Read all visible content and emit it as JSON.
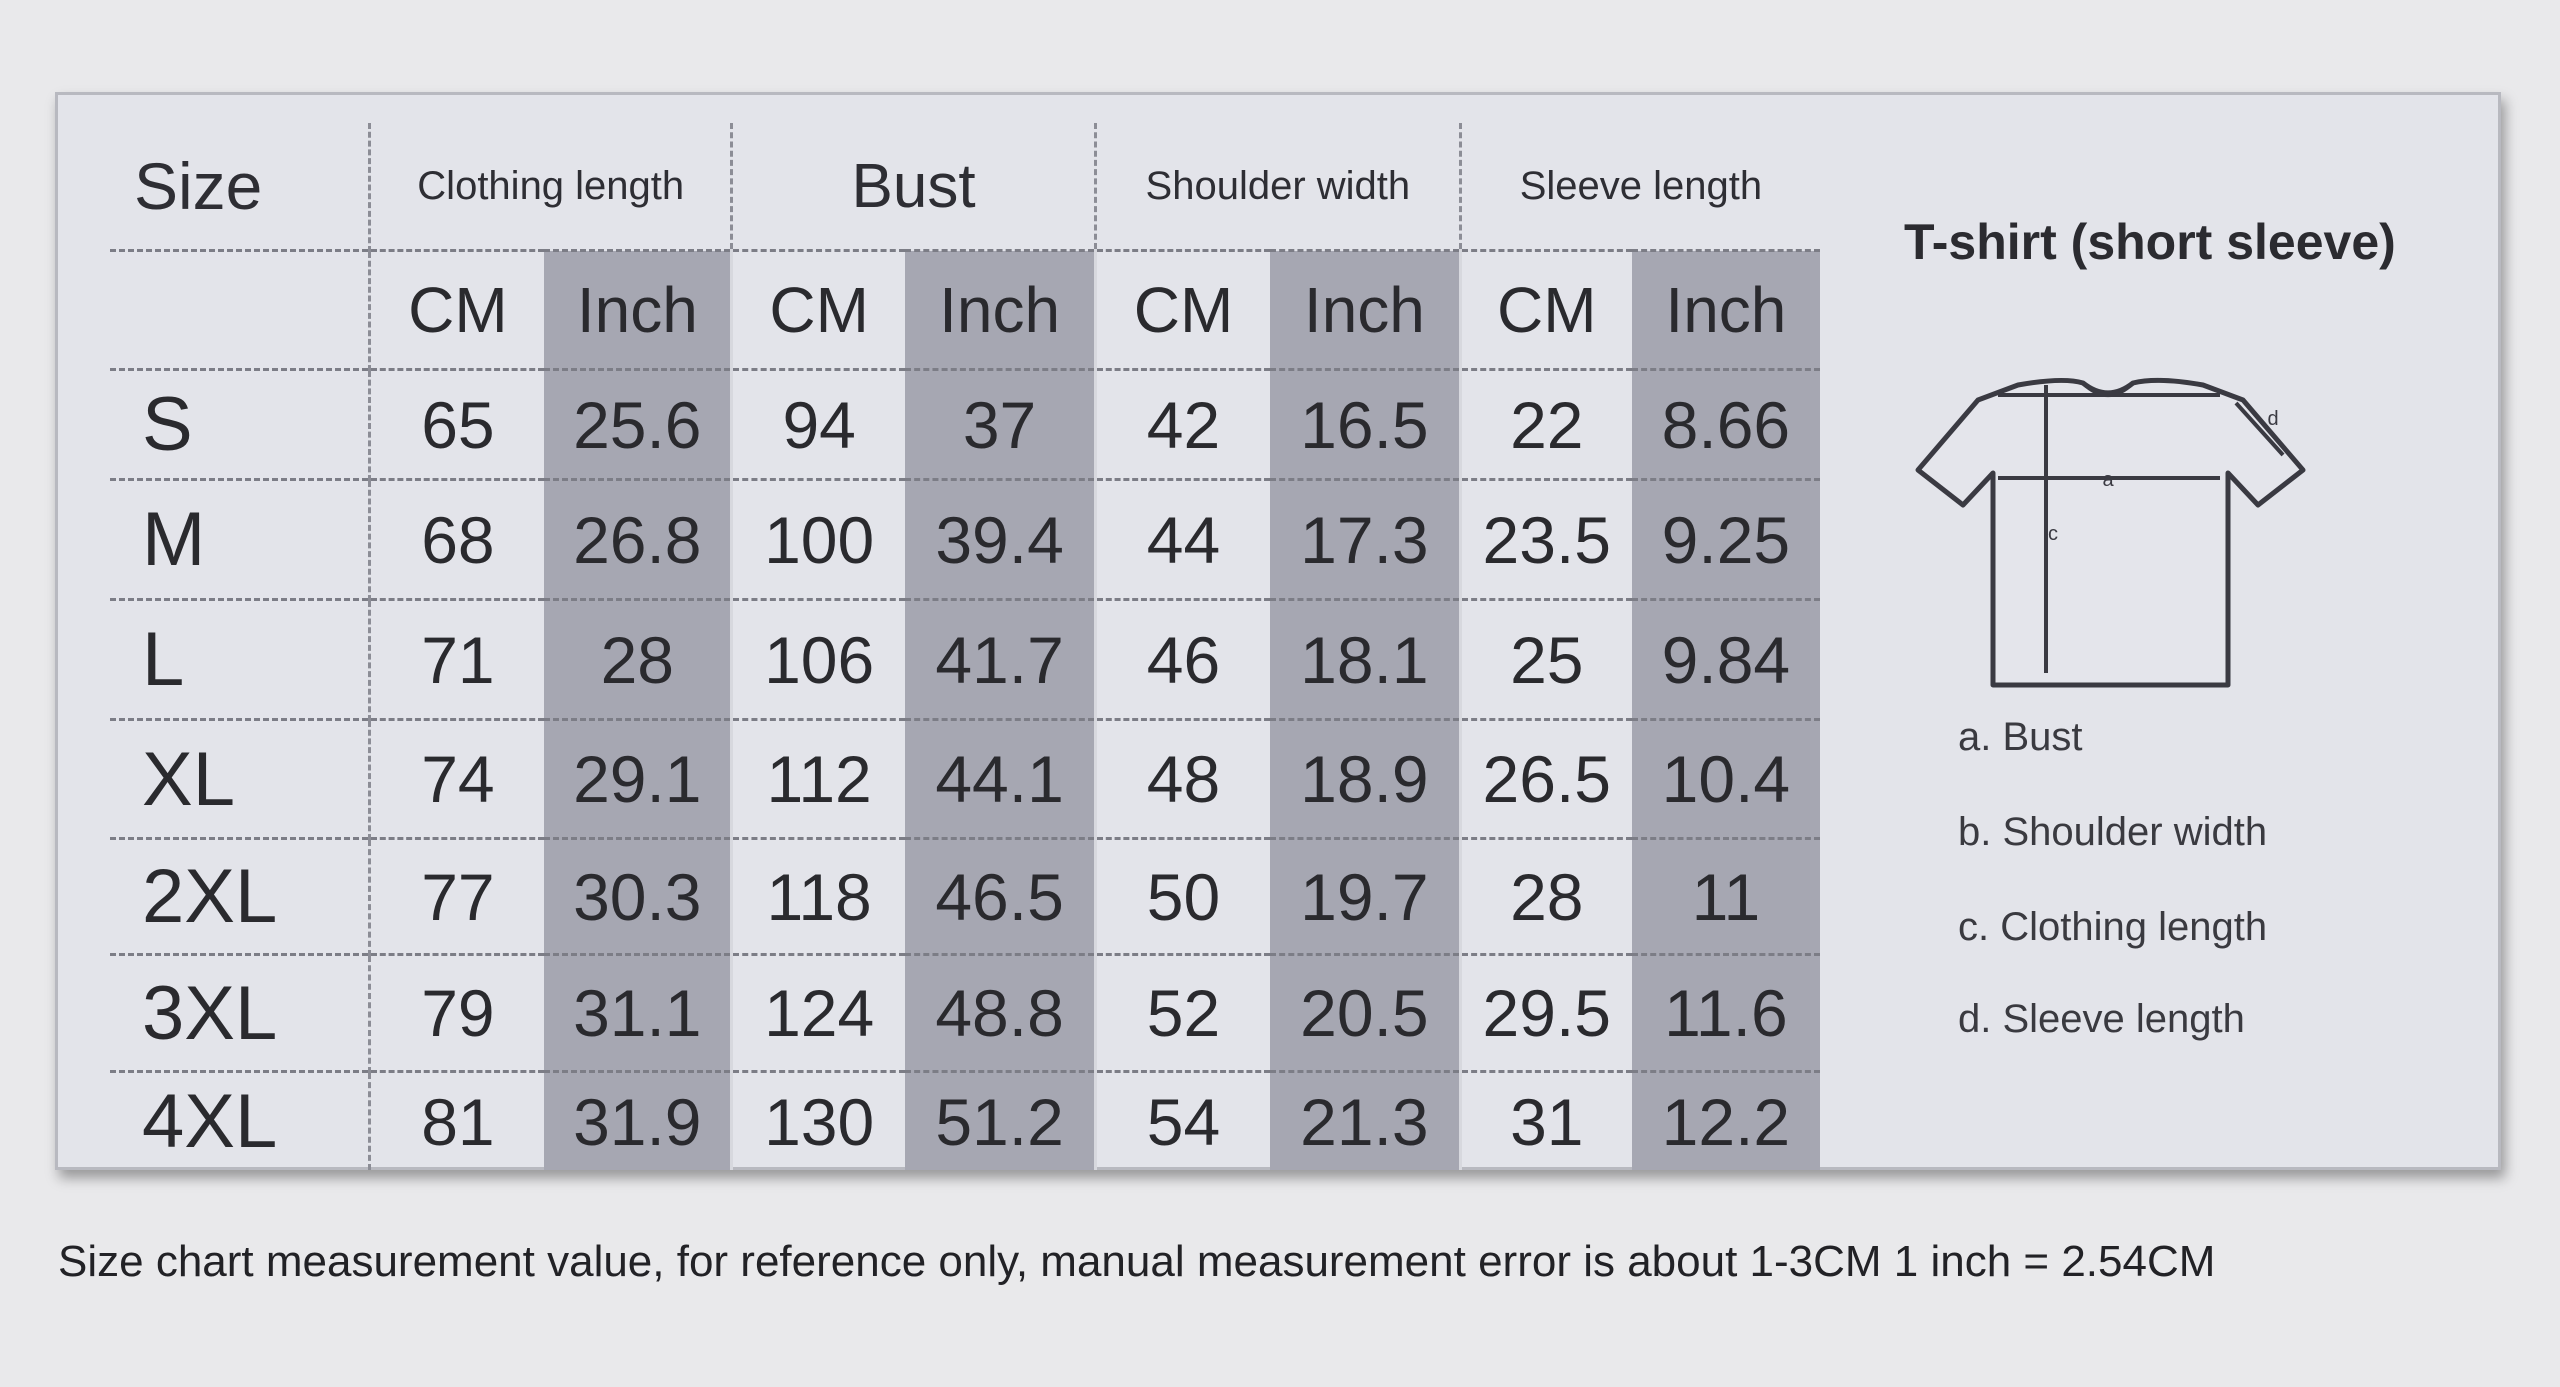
{
  "table": {
    "size_header": "Size",
    "groups": [
      "Clothing length",
      "Bust",
      "Shoulder width",
      "Sleeve length"
    ],
    "unit_cm": "CM",
    "unit_inch": "Inch",
    "rows": [
      {
        "size": "S",
        "values": [
          "65",
          "25.6",
          "94",
          "37",
          "42",
          "16.5",
          "22",
          "8.66"
        ]
      },
      {
        "size": "M",
        "values": [
          "68",
          "26.8",
          "100",
          "39.4",
          "44",
          "17.3",
          "23.5",
          "9.25"
        ]
      },
      {
        "size": "L",
        "values": [
          "71",
          "28",
          "106",
          "41.7",
          "46",
          "18.1",
          "25",
          "9.84"
        ]
      },
      {
        "size": "XL",
        "values": [
          "74",
          "29.1",
          "112",
          "44.1",
          "48",
          "18.9",
          "26.5",
          "10.4"
        ]
      },
      {
        "size": "2XL",
        "values": [
          "77",
          "30.3",
          "118",
          "46.5",
          "50",
          "19.7",
          "28",
          "11"
        ]
      },
      {
        "size": "3XL",
        "values": [
          "79",
          "31.1",
          "124",
          "48.8",
          "52",
          "20.5",
          "29.5",
          "11.6"
        ]
      },
      {
        "size": "4XL",
        "values": [
          "81",
          "31.9",
          "130",
          "51.2",
          "54",
          "21.3",
          "31",
          "12.2"
        ]
      }
    ]
  },
  "diagram": {
    "title": "T-shirt (short sleeve)",
    "marker_a": "a",
    "marker_c": "c",
    "marker_d": "d",
    "legend": [
      "a. Bust",
      "b. Shoulder width",
      "c. Clothing length",
      "d. Sleeve length"
    ]
  },
  "footer": "Size chart measurement value, for reference only, manual measurement error is about 1-3CM 1 inch = 2.54CM",
  "colors": {
    "background": "#e9e9eb",
    "card": "#e3e4ea",
    "inch_column_shade": "#a6a7b2",
    "text": "#2a2a2e"
  }
}
